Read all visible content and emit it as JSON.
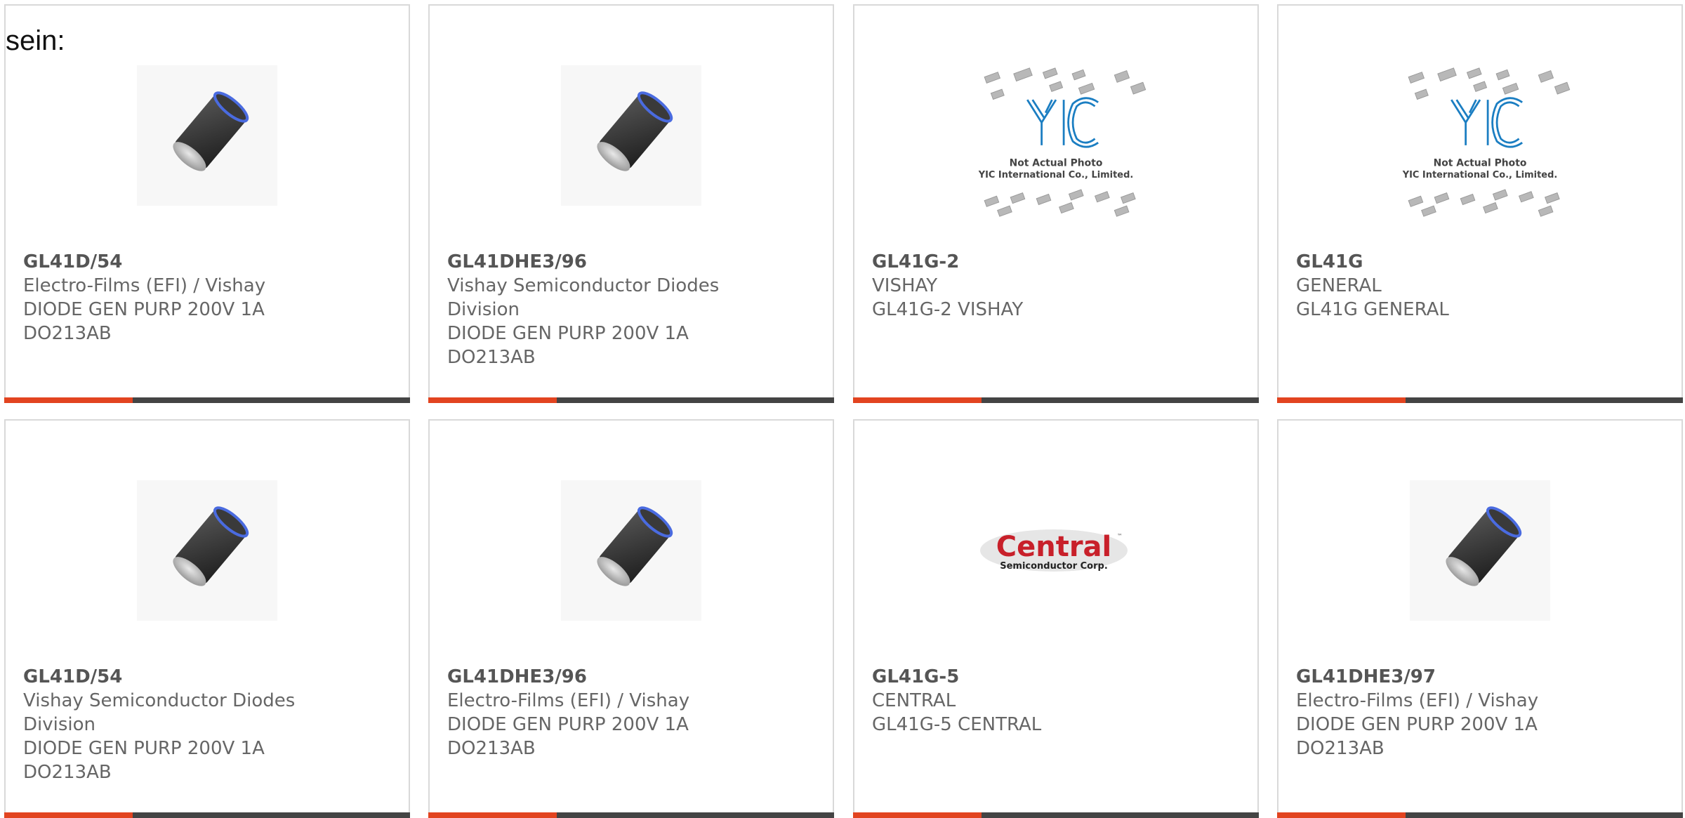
{
  "intro_text": "sein:",
  "colors": {
    "accent": "#e24420",
    "bar": "#444444",
    "border": "#d9d9d9",
    "text": "#666666"
  },
  "cards": [
    {
      "part": "GL41D/54",
      "lines": [
        "Electro-Films (EFI) / Vishay",
        "DIODE GEN PURP 200V 1A",
        "DO213AB"
      ],
      "image": "diode-cylinder"
    },
    {
      "part": "GL41DHE3/96",
      "lines": [
        "Vishay Semiconductor Diodes",
        "Division",
        "DIODE GEN PURP 200V 1A",
        "DO213AB"
      ],
      "image": "diode-cylinder"
    },
    {
      "part": "GL41G-2",
      "lines": [
        "VISHAY",
        "GL41G-2 VISHAY"
      ],
      "image": "yic-placeholder",
      "image_text": [
        "Not Actual Photo",
        "YIC International Co., Limited."
      ]
    },
    {
      "part": "GL41G",
      "lines": [
        "GENERAL",
        "GL41G GENERAL"
      ],
      "image": "yic-placeholder",
      "image_text": [
        "Not Actual Photo",
        "YIC International Co., Limited."
      ]
    },
    {
      "part": "GL41D/54",
      "lines": [
        "Vishay Semiconductor Diodes",
        "Division",
        "DIODE GEN PURP 200V 1A",
        "DO213AB"
      ],
      "image": "diode-cylinder"
    },
    {
      "part": "GL41DHE3/96",
      "lines": [
        "Electro-Films (EFI) / Vishay",
        "DIODE GEN PURP 200V 1A",
        "DO213AB"
      ],
      "image": "diode-cylinder"
    },
    {
      "part": "GL41G-5",
      "lines": [
        "CENTRAL",
        "GL41G-5 CENTRAL"
      ],
      "image": "central-logo",
      "image_text": [
        "Central",
        "Semiconductor Corp."
      ]
    },
    {
      "part": "GL41DHE3/97",
      "lines": [
        "Electro-Films (EFI) / Vishay",
        "DIODE GEN PURP 200V 1A",
        "DO213AB"
      ],
      "image": "diode-cylinder"
    }
  ]
}
